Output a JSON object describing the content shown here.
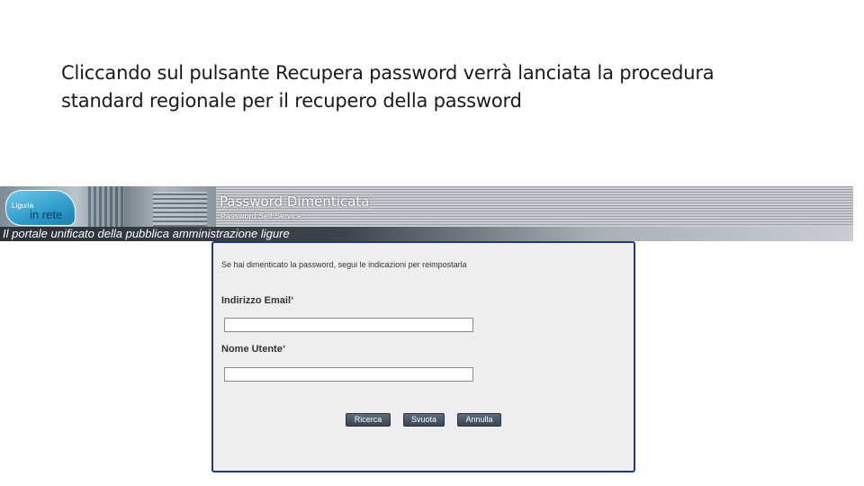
{
  "slide": {
    "text_lines": [
      "Cliccando sul pulsante Recupera password verrà lanciata la procedura",
      "standard regionale per il recupero della password"
    ]
  },
  "header": {
    "logo_small": "Liguria",
    "logo_big": "in rete",
    "title": "Password Dimenticata",
    "subtitle": "Password Self Service",
    "tagline": "Il portale unificato della pubblica amministrazione ligure"
  },
  "form": {
    "intro": "Se hai dimenticato la password, segui le indicazioni per reimpostarla",
    "email_label": "Indirizzo Email",
    "username_label": "Nome Utente",
    "required_marker": "*",
    "email_value": "",
    "username_value": "",
    "buttons": {
      "search": "Ricerca",
      "clear": "Svuota",
      "cancel": "Annulla"
    }
  },
  "colors": {
    "panel_border": "#1f3a78",
    "panel_background": "#eeeeee",
    "button_background": "#4a5666"
  }
}
